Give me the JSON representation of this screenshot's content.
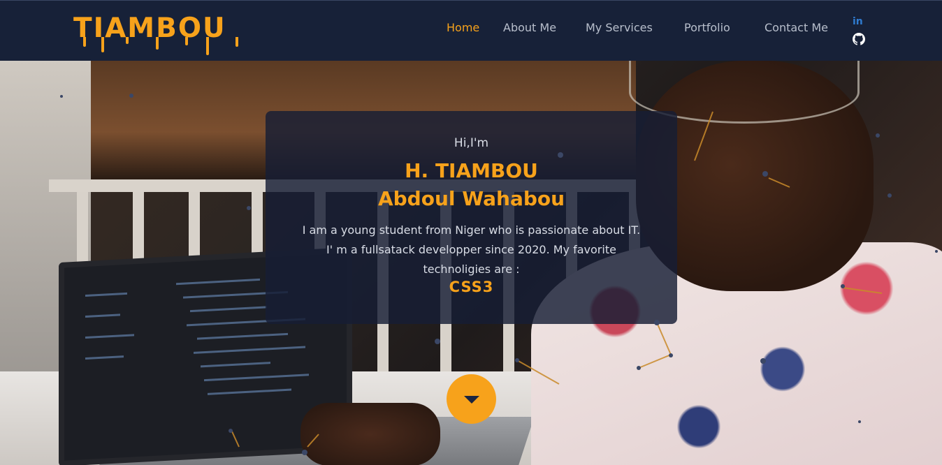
{
  "brand": {
    "logo_text": "TIAMBOU",
    "accent_color": "#f7a21b",
    "nav_bg": "#172138"
  },
  "nav": {
    "items": [
      {
        "label": "Home",
        "active": true
      },
      {
        "label": "About Me",
        "active": false
      },
      {
        "label": "My Services",
        "active": false
      },
      {
        "label": "Portfolio",
        "active": false
      },
      {
        "label": "Contact Me",
        "active": false
      }
    ],
    "social": [
      {
        "icon": "linkedin-icon",
        "glyph": "in"
      },
      {
        "icon": "github-icon"
      }
    ]
  },
  "hero": {
    "greeting": "Hi,I'm",
    "name_line1": "H. TIAMBOU",
    "name_line2": "Abdoul Wahabou",
    "bio_line1": "I am a young student from Niger who is passionate about IT.",
    "bio_line2": "I' m a fullsatack developper since 2020. My favorite",
    "bio_line3": "technoligies are :",
    "technology": "CSS3",
    "scroll_button_icon": "chevron-down-icon"
  }
}
